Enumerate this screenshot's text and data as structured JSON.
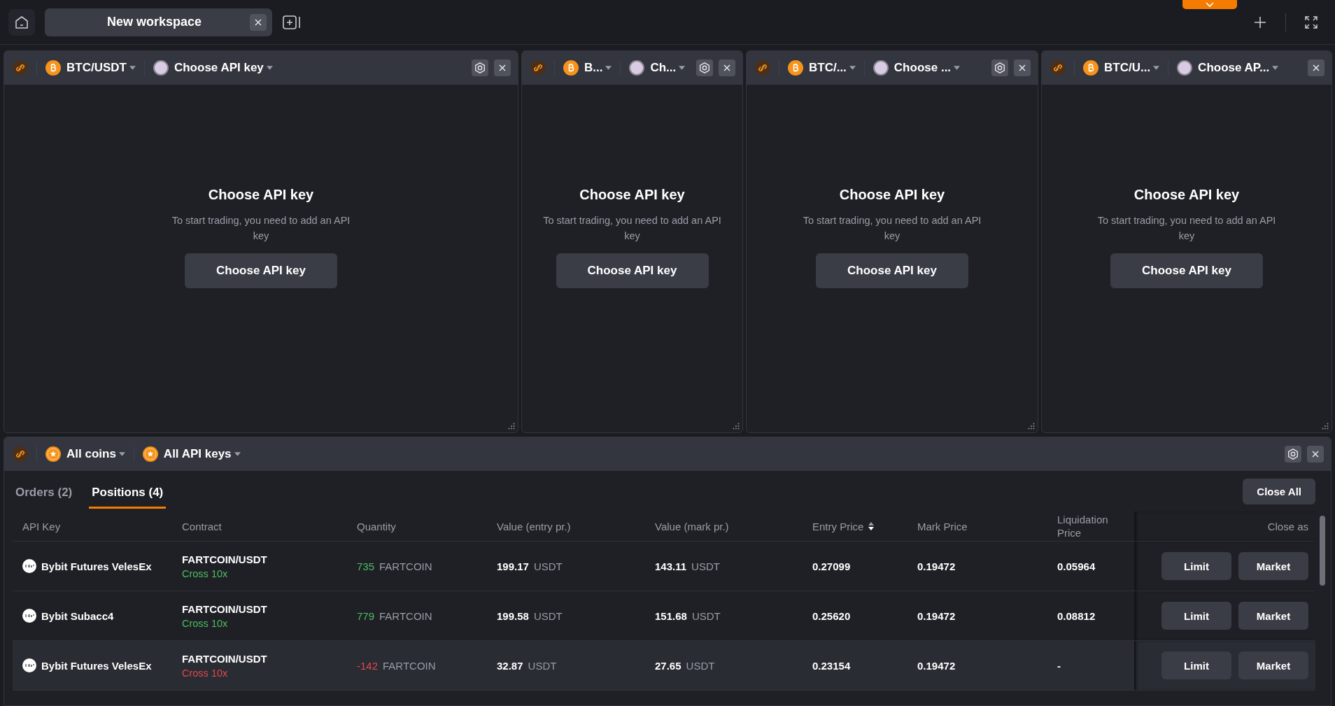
{
  "top_bar": {
    "workspace_tab": {
      "label": "New workspace",
      "selected": true
    }
  },
  "widgets": [
    {
      "pair": "BTC/USDT",
      "api_key": "Choose API key",
      "has_settings": true,
      "title": "Choose API key",
      "description": "To start trading, you need to add an API key",
      "button": "Choose API key"
    },
    {
      "pair": "B...",
      "api_key": "Ch...",
      "has_settings": true,
      "title": "Choose API key",
      "description": "To start trading, you need to add an API key",
      "button": "Choose API key"
    },
    {
      "pair": "BTC/...",
      "api_key": "Choose ...",
      "has_settings": true,
      "title": "Choose API key",
      "description": "To start trading, you need to add an API key",
      "button": "Choose API key"
    },
    {
      "pair": "BTC/U...",
      "api_key": "Choose AP...",
      "has_settings": false,
      "title": "Choose API key",
      "description": "To start trading, you need to add an API key",
      "button": "Choose API key"
    }
  ],
  "positions_panel": {
    "coins_filter": "All coins",
    "api_keys_filter": "All API keys",
    "tabs": [
      {
        "label": "Orders (2)",
        "selected": false
      },
      {
        "label": "Positions (4)",
        "selected": true
      }
    ],
    "close_all": "Close All",
    "columns": [
      "API Key",
      "Contract",
      "Quantity",
      "Value (entry pr.)",
      "Value (mark pr.)",
      "Entry Price",
      "Mark Price",
      "Liquidation Price",
      "Close as"
    ],
    "rows": [
      {
        "api_key": "Bybit Futures VelesEx",
        "contract": "FARTCOIN/USDT",
        "margin": "Cross 10x",
        "kind": "long",
        "quantity": "735",
        "quantity_unit": "FARTCOIN",
        "value_entry": "199.17",
        "value_entry_unit": "USDT",
        "value_mark": "143.11",
        "value_mark_unit": "USDT",
        "entry_price": "0.27099",
        "mark_price": "0.19472",
        "liquidation_price": "0.05964",
        "actions": [
          "Limit",
          "Market"
        ],
        "highlighted": false
      },
      {
        "api_key": "Bybit Subacc4",
        "contract": "FARTCOIN/USDT",
        "margin": "Cross 10x",
        "kind": "long",
        "quantity": "779",
        "quantity_unit": "FARTCOIN",
        "value_entry": "199.58",
        "value_entry_unit": "USDT",
        "value_mark": "151.68",
        "value_mark_unit": "USDT",
        "entry_price": "0.25620",
        "mark_price": "0.19472",
        "liquidation_price": "0.08812",
        "actions": [
          "Limit",
          "Market"
        ],
        "highlighted": false
      },
      {
        "api_key": "Bybit Futures VelesEx",
        "contract": "FARTCOIN/USDT",
        "margin": "Cross 10x",
        "kind": "short",
        "quantity": "-142",
        "quantity_unit": "FARTCOIN",
        "value_entry": "32.87",
        "value_entry_unit": "USDT",
        "value_mark": "27.65",
        "value_mark_unit": "USDT",
        "entry_price": "0.23154",
        "mark_price": "0.19472",
        "liquidation_price": "-",
        "actions": [
          "Limit",
          "Market"
        ],
        "highlighted": true
      }
    ]
  }
}
